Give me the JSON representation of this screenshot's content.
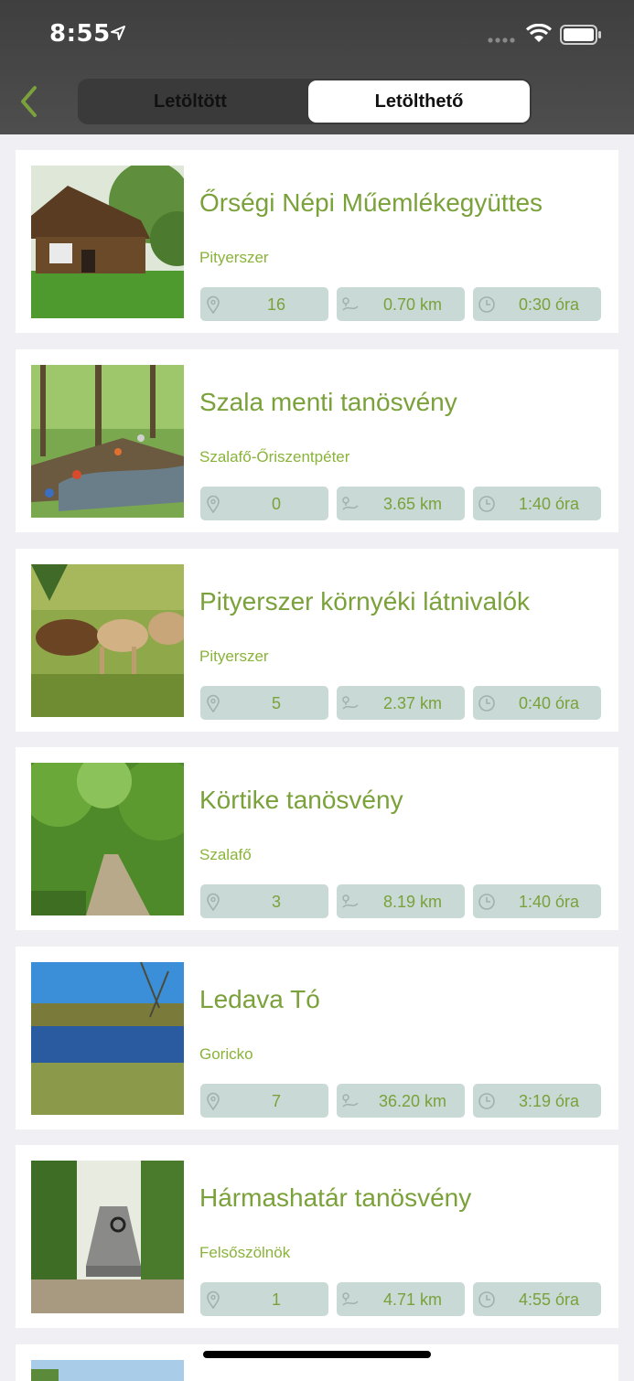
{
  "status": {
    "time": "8:55"
  },
  "tabs": [
    {
      "label": "Letöltött",
      "selected": false
    },
    {
      "label": "Letölthető",
      "selected": true
    }
  ],
  "icons": {
    "back": "chevron-left-icon",
    "location": "map-pin-icon",
    "route": "route-icon",
    "time": "clock-icon"
  },
  "colors": {
    "accent": "#7aa13a",
    "chip_bg": "#c9d9d5"
  },
  "trails": [
    {
      "title": "Őrségi Népi Műemlékegyüttes",
      "location": "Pityerszer",
      "points": "16",
      "distance": "0.70 km",
      "duration": "0:30 óra"
    },
    {
      "title": "Szala menti tanösvény",
      "location": "Szalafő-Őriszentpéter",
      "points": "0",
      "distance": "3.65 km",
      "duration": "1:40 óra"
    },
    {
      "title": "Pityerszer környéki látnivalók",
      "location": "Pityerszer",
      "points": "5",
      "distance": "2.37 km",
      "duration": "0:40 óra"
    },
    {
      "title": "Körtike tanösvény",
      "location": "Szalafő",
      "points": "3",
      "distance": "8.19 km",
      "duration": "1:40 óra"
    },
    {
      "title": "Ledava Tó",
      "location": "Goricko",
      "points": "7",
      "distance": "36.20 km",
      "duration": "3:19 óra"
    },
    {
      "title": "Hármashatár tanösvény",
      "location": "Felsőszölnök",
      "points": "1",
      "distance": "4.71 km",
      "duration": "4:55 óra"
    }
  ]
}
